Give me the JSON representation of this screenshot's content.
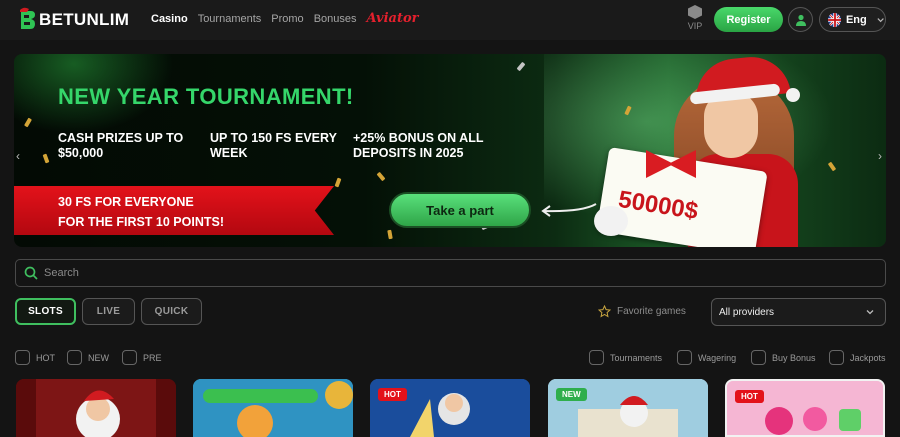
{
  "header": {
    "logo_text": "BETUNLIM",
    "nav": [
      "Casino",
      "Tournaments",
      "Promo",
      "Bonuses",
      "Aviator"
    ],
    "vip_label": "VIP",
    "register_label": "Register",
    "language": "Eng"
  },
  "banner": {
    "title": "NEW YEAR TOURNAMENT!",
    "perks": [
      "CASH PRIZES UP TO $50,000",
      "UP TO 150 FS EVERY WEEK",
      "+25% BONUS ON ALL DEPOSITS IN 2025"
    ],
    "ribbon_line1": "30 FS FOR EVERYONE",
    "ribbon_line2": "FOR THE FIRST 10 POINTS!",
    "cta_label": "Take a part",
    "check_amount": "50000$",
    "prev_label": "‹",
    "next_label": "›"
  },
  "search": {
    "placeholder": "Search"
  },
  "tabs": [
    "SLOTS",
    "LIVE",
    "QUICK"
  ],
  "favorite_label": "Favorite games",
  "provider_select": {
    "value": "All providers"
  },
  "left_filters": [
    "HOT",
    "NEW",
    "PRE"
  ],
  "right_filters": [
    "Tournaments",
    "Wagering",
    "Buy Bonus",
    "Jackpots"
  ],
  "cards": [
    {
      "badge": ""
    },
    {
      "badge": ""
    },
    {
      "badge": "HOT"
    },
    {
      "badge": "NEW"
    },
    {
      "badge": "HOT"
    }
  ],
  "colors": {
    "accent": "#3fbf5f",
    "banner_title": "#35d66a",
    "ribbon": "#e3121a",
    "aviator": "#e5202d"
  },
  "icons": [
    "logo-mark-icon",
    "vip-hex-icon",
    "user-icon",
    "uk-flag-icon",
    "chevron-down-icon",
    "search-icon",
    "star-icon",
    "arrow-left-icon"
  ]
}
